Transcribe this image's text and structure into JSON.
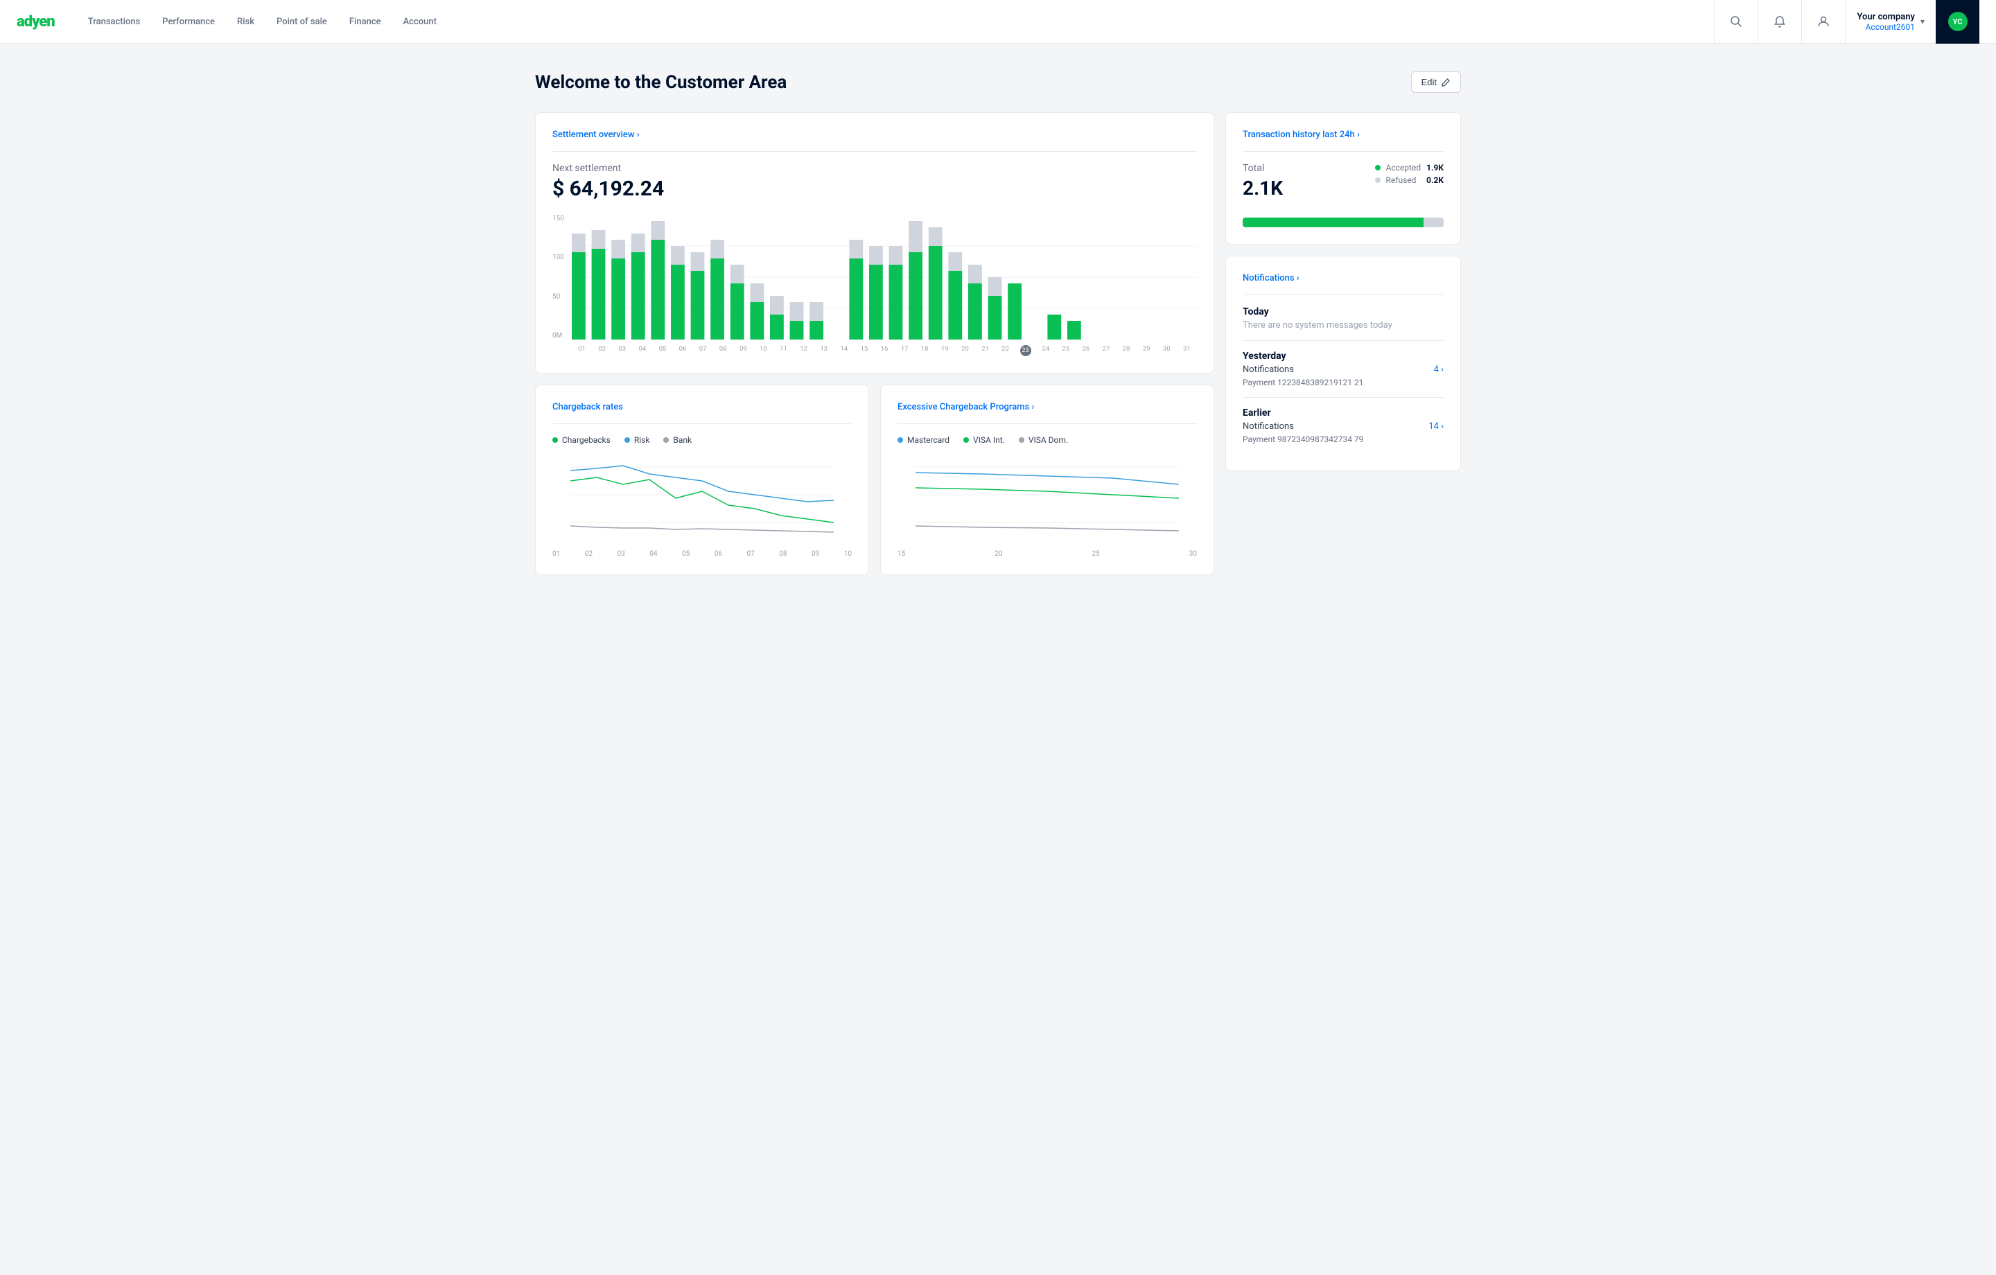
{
  "brand": {
    "name_green": "adyen",
    "logo_text": "adyen"
  },
  "navbar": {
    "nav_items": [
      {
        "label": "Transactions",
        "id": "transactions"
      },
      {
        "label": "Performance",
        "id": "performance"
      },
      {
        "label": "Risk",
        "id": "risk"
      },
      {
        "label": "Point of sale",
        "id": "pos"
      },
      {
        "label": "Finance",
        "id": "finance"
      },
      {
        "label": "Account",
        "id": "account"
      }
    ],
    "account": {
      "company": "Your company",
      "account_id": "Account2601"
    },
    "edit_label": "Edit"
  },
  "page": {
    "title": "Welcome to the Customer Area"
  },
  "settlement": {
    "card_title": "Settlement overview ›",
    "next_settlement_label": "Next settlement",
    "amount": "$ 64,192.24"
  },
  "bar_chart": {
    "y_labels": [
      "150",
      "100",
      "50",
      "0M"
    ],
    "x_labels": [
      "01",
      "02",
      "03",
      "04",
      "05",
      "06",
      "07",
      "08",
      "09",
      "10",
      "11",
      "12",
      "13",
      "14",
      "15",
      "16",
      "17",
      "18",
      "19",
      "20",
      "21",
      "22",
      "23",
      "24",
      "25",
      "26",
      "27",
      "28",
      "29",
      "30",
      "31"
    ],
    "active_label": "23"
  },
  "transaction_history": {
    "card_title": "Transaction history last 24h ›",
    "total_label": "Total",
    "total_value": "2.1K",
    "legend": [
      {
        "label": "Accepted",
        "value": "1.9K",
        "color": "#0abf53"
      },
      {
        "label": "Refused",
        "value": "0.2K",
        "color": "#d0d5dd"
      }
    ]
  },
  "chargeback": {
    "card_title": "Chargeback rates",
    "legend": [
      {
        "label": "Chargebacks",
        "color": "#0abf53"
      },
      {
        "label": "Risk",
        "color": "#3b9ede"
      },
      {
        "label": "Bank",
        "color": "#9aa3af"
      }
    ],
    "x_labels": [
      "01",
      "02",
      "03",
      "04",
      "05",
      "06",
      "07",
      "08",
      "09",
      "10"
    ]
  },
  "excessive_chargeback": {
    "card_title": "Excessive Chargeback Programs ›",
    "legend": [
      {
        "label": "Mastercard",
        "color": "#3b9ede"
      },
      {
        "label": "VISA Int.",
        "color": "#0abf53"
      },
      {
        "label": "VISA Dom.",
        "color": "#9aa3af"
      }
    ],
    "x_labels": [
      "15",
      "20",
      "25",
      "30"
    ]
  },
  "notifications": {
    "card_title": "Notifications ›",
    "today": {
      "label": "Today",
      "message": "There are no system messages today"
    },
    "yesterday": {
      "label": "Yesterday",
      "notif_label": "Notifications",
      "notif_count": "4 ›",
      "payment_label": "Payment 1223848389219121 21"
    },
    "earlier": {
      "label": "Earlier",
      "notif_label": "Notifications",
      "notif_count": "14 ›",
      "payment_label": "Payment 9872340987342734 79"
    }
  }
}
